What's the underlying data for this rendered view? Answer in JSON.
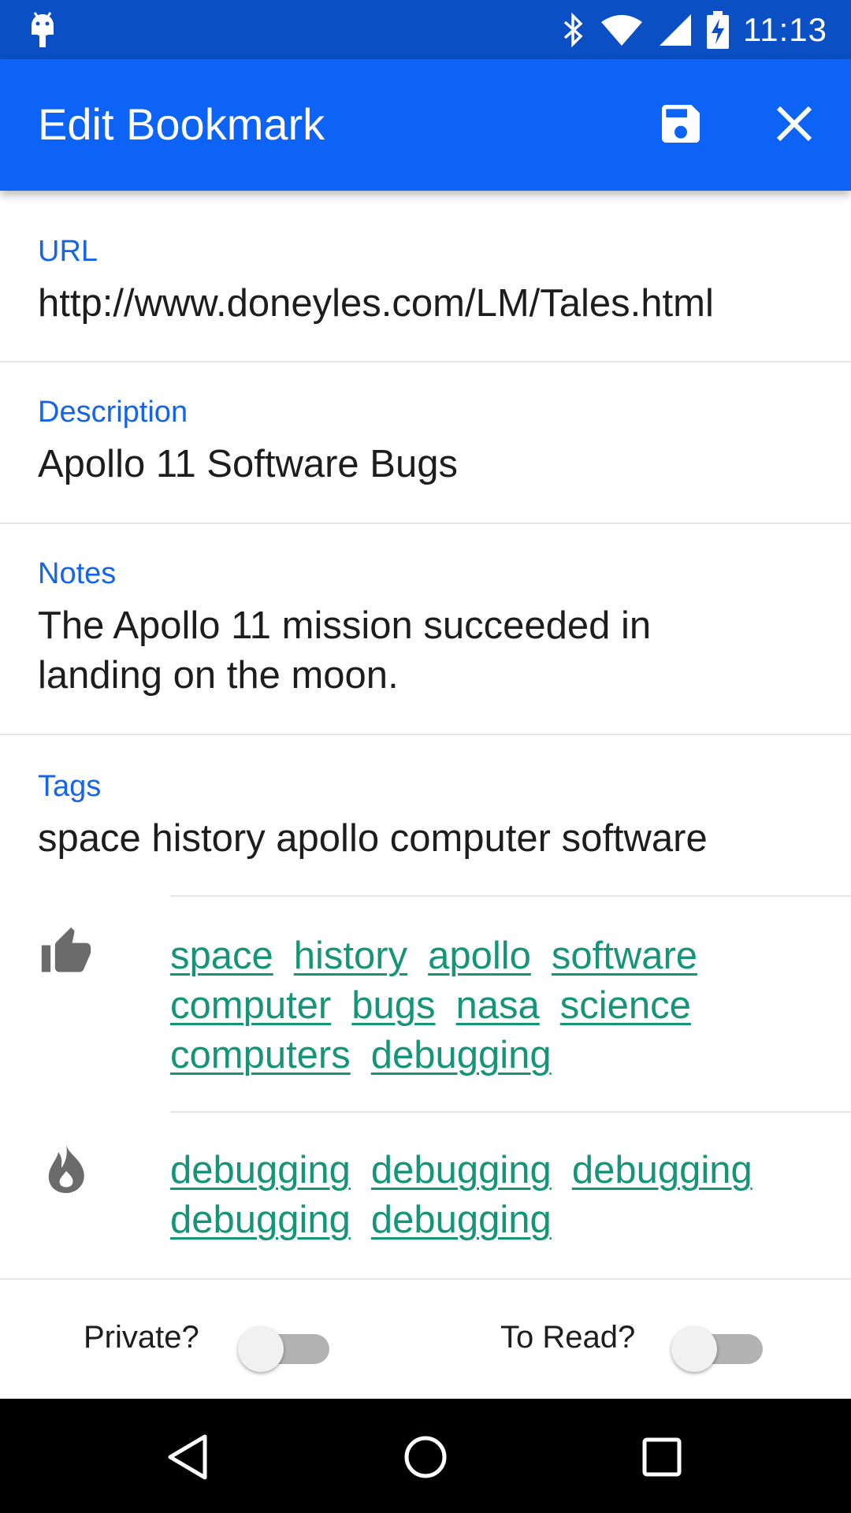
{
  "status_bar": {
    "time": "11:13",
    "icons": [
      "android-debug-icon",
      "bluetooth-icon",
      "wifi-icon",
      "signal-icon",
      "battery-charging-icon"
    ]
  },
  "app_bar": {
    "title": "Edit Bookmark",
    "actions": [
      "save-icon",
      "close-icon"
    ],
    "color": "#0d63f5"
  },
  "form": {
    "url": {
      "label": "URL",
      "value": "http://www.doneyles.com/LM/Tales.html"
    },
    "description": {
      "label": "Description",
      "value": "Apollo 11 Software Bugs"
    },
    "notes": {
      "label": "Notes",
      "value": "The Apollo 11 mission succeeded in landing on the moon."
    },
    "tags": {
      "label": "Tags",
      "value": "space history apollo computer software"
    }
  },
  "suggested_tags": {
    "popular": {
      "icon": "thumbs-up-icon",
      "tags": [
        "space",
        "history",
        "apollo",
        "software",
        "computer",
        "bugs",
        "nasa",
        "science",
        "computers",
        "debugging"
      ]
    },
    "recommended": {
      "icon": "flame-icon",
      "tags": [
        "debugging",
        "debugging",
        "debugging",
        "debugging",
        "debugging"
      ]
    },
    "link_color": "#159477"
  },
  "toggles": {
    "private": {
      "label": "Private?",
      "on": false
    },
    "to_read": {
      "label": "To Read?",
      "on": false
    }
  },
  "nav_bar": {
    "buttons": [
      "back-icon",
      "home-icon",
      "recents-icon"
    ]
  },
  "colors": {
    "label_accent": "#1565e6",
    "status_bar": "#0a4fc4"
  }
}
